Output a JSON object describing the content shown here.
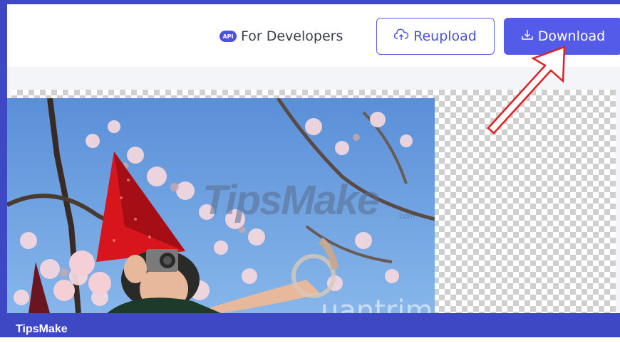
{
  "header": {
    "api_badge": "API",
    "for_developers": "For Developers",
    "reupload_label": "Reupload",
    "download_label": "Download"
  },
  "watermarks": {
    "tipsmake": "TipsMake",
    "tipsmake_suffix": ".com",
    "quantrimang": "uantrimang"
  },
  "footer": {
    "brand": "TipsMake"
  },
  "colors": {
    "frame": "#3f48c4",
    "accent": "#545be8",
    "annotation_arrow": "#e02020"
  },
  "icons": {
    "upload": "cloud-upload-icon",
    "download": "download-icon"
  }
}
